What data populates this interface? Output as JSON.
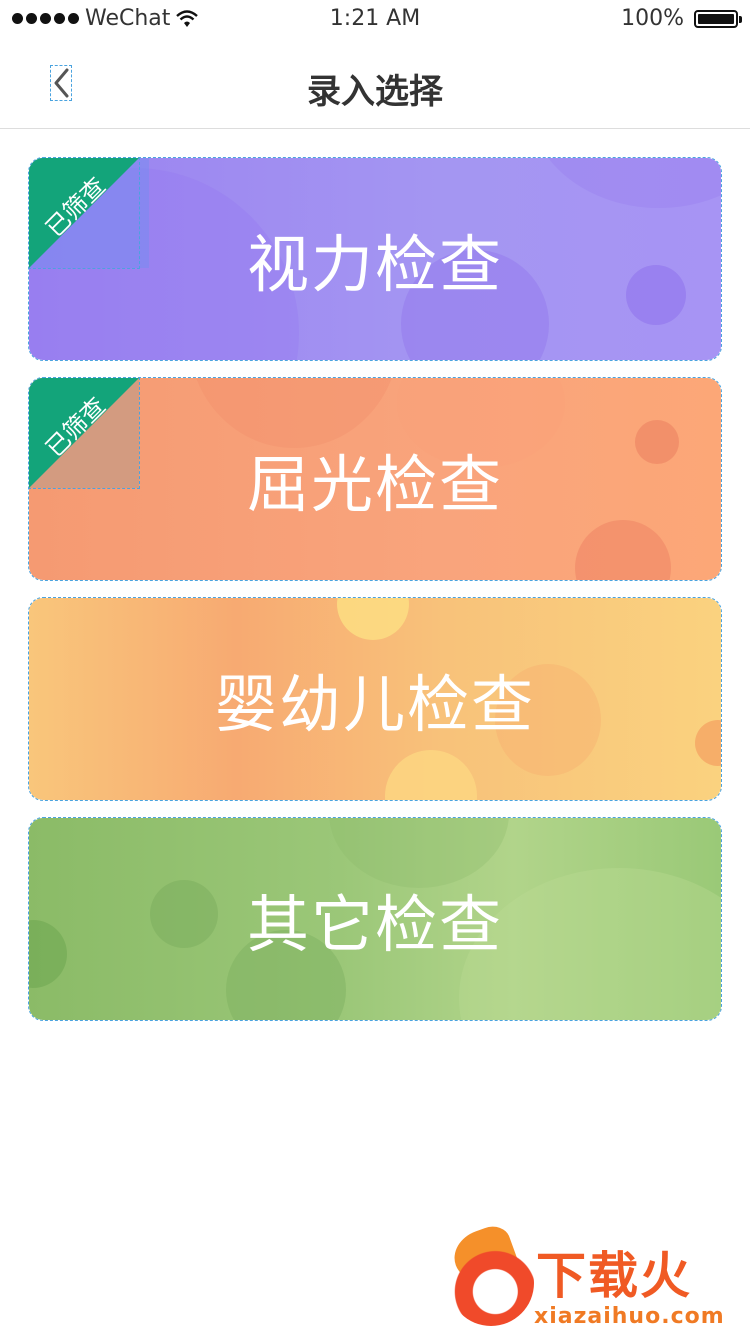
{
  "status_bar": {
    "carrier": "WeChat",
    "time": "1:21 AM",
    "battery": "100%",
    "battery_level": 1.0
  },
  "nav": {
    "title": "录入选择"
  },
  "cards": [
    {
      "label": "视力检查",
      "badge": "已筛查"
    },
    {
      "label": "屈光检查",
      "badge": "已筛查"
    },
    {
      "label": "婴幼儿检查",
      "badge": ""
    },
    {
      "label": "其它检查",
      "badge": ""
    }
  ],
  "watermark": {
    "brand": "下载火",
    "domain": "xiazaihuo.com"
  },
  "colors": {
    "badge": "#13a47a",
    "card_vision": "#9a82f0",
    "card_refraction": "#f59a72",
    "card_infant": "#f9c67b",
    "card_other": "#8bbb67"
  },
  "icons": {
    "back": "chevron-left-icon",
    "signal": "signal-dots-icon",
    "wifi": "wifi-icon",
    "battery": "battery-icon"
  }
}
